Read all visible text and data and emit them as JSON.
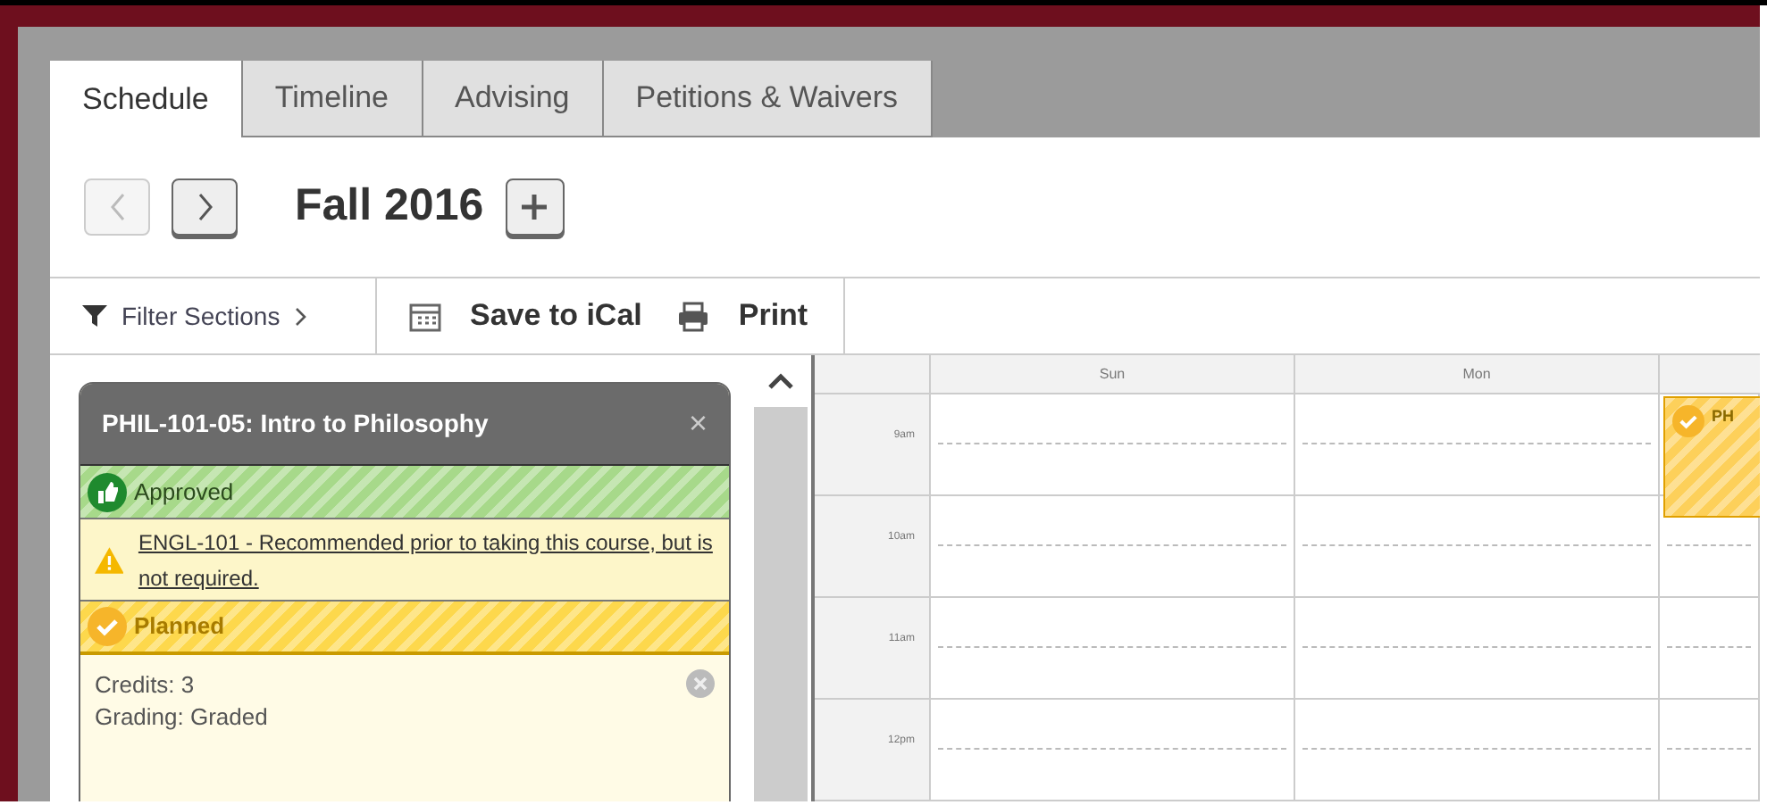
{
  "tabs": [
    {
      "label": "Schedule",
      "selected": true
    },
    {
      "label": "Timeline",
      "selected": false
    },
    {
      "label": "Advising",
      "selected": false
    },
    {
      "label": "Petitions & Waivers",
      "selected": false
    }
  ],
  "term": {
    "prev_disabled": true,
    "next_disabled": false,
    "title": "Fall 2016"
  },
  "toolbar": {
    "filter": "Filter Sections",
    "save": "Save to iCal",
    "print": "Print"
  },
  "course_card": {
    "title": "PHIL-101-05: Intro to Philosophy",
    "close": "×",
    "statuses": [
      {
        "kind": "approved",
        "label": "Approved"
      },
      {
        "kind": "warning",
        "label": "ENGL-101 - Recommended prior to taking this course, but is not required."
      },
      {
        "kind": "planned",
        "label": "Planned"
      }
    ],
    "details": [
      "Credits: 3",
      "Grading: Graded"
    ]
  },
  "calendar": {
    "days": [
      "Sun",
      "Mon"
    ],
    "times": [
      "9am",
      "10am",
      "11am",
      "12pm"
    ],
    "event": {
      "title": "PH"
    }
  }
}
